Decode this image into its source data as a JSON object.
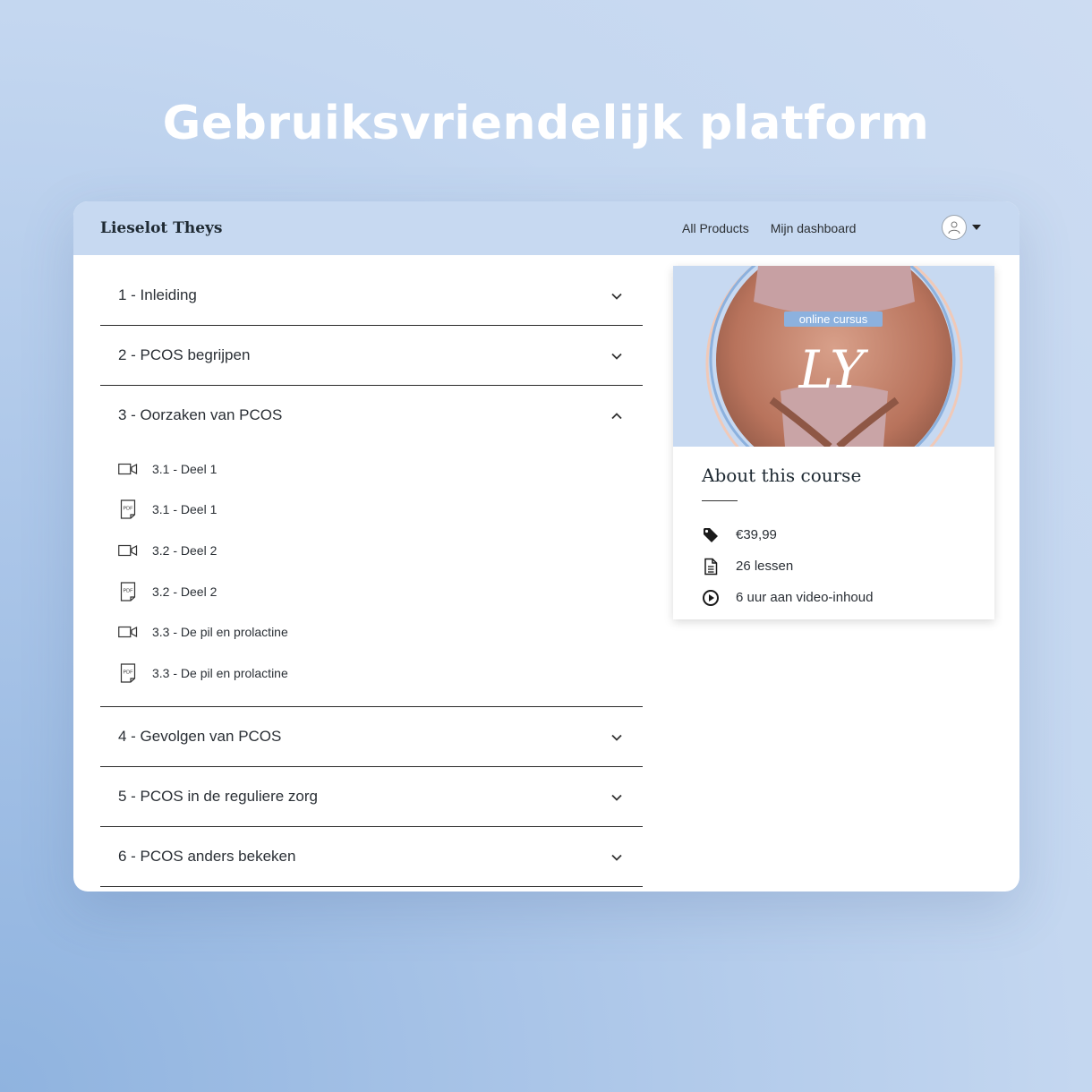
{
  "headline": "Gebruiksvriendelijk platform",
  "header": {
    "brand": "Lieselot Theys",
    "nav": [
      "All Products",
      "Mijn dashboard"
    ]
  },
  "sections": [
    {
      "title": "1 - Inleiding",
      "expanded": false
    },
    {
      "title": "2 - PCOS begrijpen",
      "expanded": false
    },
    {
      "title": "3 - Oorzaken van PCOS",
      "expanded": true,
      "lessons": [
        {
          "type": "video-icon",
          "title": "3.1 - Deel 1"
        },
        {
          "type": "pdf-icon",
          "title": "3.1 - Deel 1"
        },
        {
          "type": "video-icon",
          "title": "3.2 - Deel 2"
        },
        {
          "type": "pdf-icon",
          "title": "3.2 - Deel 2"
        },
        {
          "type": "video-icon",
          "title": "3.3 - De pil en prolactine"
        },
        {
          "type": "pdf-icon",
          "title": "3.3 - De pil en prolactine"
        }
      ]
    },
    {
      "title": "4 - Gevolgen van PCOS",
      "expanded": false
    },
    {
      "title": "5 - PCOS in de reguliere zorg",
      "expanded": false
    },
    {
      "title": "6 - PCOS anders bekeken",
      "expanded": false
    }
  ],
  "course": {
    "image_badge": "online cursus",
    "image_logo": "LY",
    "title": "About this course",
    "price": "€39,99",
    "lessons": "26 lessen",
    "video": "6 uur aan video-inhoud"
  },
  "colors": {
    "topbar": "#c7d9f1",
    "badge": "#8cb1de",
    "text": "#2a2f35"
  }
}
